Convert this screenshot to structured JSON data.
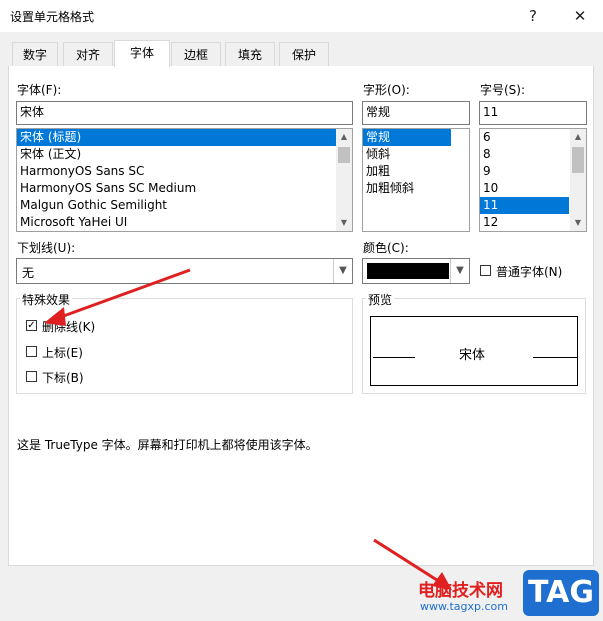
{
  "window": {
    "title": "设置单元格格式",
    "help_glyph": "?",
    "close_glyph": "✕"
  },
  "tabs": [
    {
      "label": "数字"
    },
    {
      "label": "对齐"
    },
    {
      "label": "字体"
    },
    {
      "label": "边框"
    },
    {
      "label": "填充"
    },
    {
      "label": "保护"
    }
  ],
  "active_tab": "字体",
  "font": {
    "label": "字体(F):",
    "value": "宋体",
    "items": [
      "宋体 (标题)",
      "宋体 (正文)",
      "HarmonyOS Sans SC",
      "HarmonyOS Sans SC Medium",
      "Malgun Gothic Semilight",
      "Microsoft YaHei UI"
    ],
    "selected": "宋体 (标题)"
  },
  "style": {
    "label": "字形(O):",
    "value": "常规",
    "items": [
      "常规",
      "倾斜",
      "加粗",
      "加粗倾斜"
    ],
    "selected": "常规"
  },
  "size": {
    "label": "字号(S):",
    "value": "11",
    "items": [
      "6",
      "8",
      "9",
      "10",
      "11",
      "12"
    ],
    "selected": "11"
  },
  "underline": {
    "label": "下划线(U):",
    "value": "无"
  },
  "color": {
    "label": "颜色(C):",
    "swatch": "#000000",
    "normal_font_label": "普通字体(N)",
    "normal_font_checked": false
  },
  "effects": {
    "title": "特殊效果",
    "strikethrough": {
      "label": "删除线(K)",
      "checked": true
    },
    "superscript": {
      "label": "上标(E)",
      "checked": false
    },
    "subscript": {
      "label": "下标(B)",
      "checked": false
    }
  },
  "preview": {
    "title": "预览",
    "sample": "宋体"
  },
  "info_text": "这是 TrueType 字体。屏幕和打印机上都将使用该字体。",
  "watermark": {
    "site": "电脑技术网",
    "url": "www.tagxp.com",
    "badge": "TAG"
  },
  "colors": {
    "selection": "#0078d7",
    "annotation_arrow": "#e02020"
  }
}
